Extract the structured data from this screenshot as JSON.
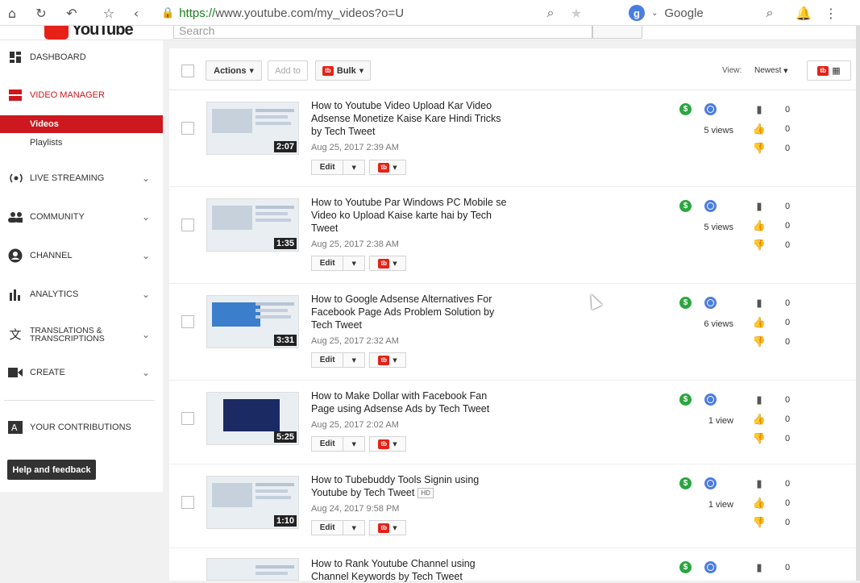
{
  "browser": {
    "url_secure": "https://",
    "url_rest": "www.youtube.com/my_videos?o=U",
    "search_engine": "Google"
  },
  "yt_header": {
    "logo_text": "YouTube",
    "search_placeholder": "Search"
  },
  "sidebar": {
    "items": [
      {
        "label": "DASHBOARD",
        "icon": "dashboard-icon"
      },
      {
        "label": "VIDEO MANAGER",
        "icon": "video-manager-icon"
      },
      {
        "label": "LIVE STREAMING",
        "icon": "live-icon"
      },
      {
        "label": "COMMUNITY",
        "icon": "community-icon"
      },
      {
        "label": "CHANNEL",
        "icon": "channel-icon"
      },
      {
        "label": "ANALYTICS",
        "icon": "analytics-icon"
      },
      {
        "label": "TRANSLATIONS & TRANSCRIPTIONS",
        "icon": "translate-icon"
      },
      {
        "label": "CREATE",
        "icon": "create-icon"
      },
      {
        "label": "YOUR CONTRIBUTIONS",
        "icon": "contributions-icon"
      }
    ],
    "sub_videos": "Videos",
    "sub_playlists": "Playlists",
    "help_label": "Help and feedback"
  },
  "toolbar": {
    "actions_label": "Actions",
    "addto_label": "Add to",
    "bulk_label": "Bulk",
    "view_label": "View:",
    "view_value": "Newest"
  },
  "edit_label": "Edit",
  "videos": [
    {
      "title": "How to Youtube Video Upload Kar Video Adsense Monetize Kaise Kare Hindi Tricks by Tech Tweet",
      "date": "Aug 25, 2017 2:39 AM",
      "duration": "2:07",
      "views": "5 views",
      "comments": "0",
      "likes": "0",
      "dislikes": "0"
    },
    {
      "title": "How to Youtube Par Windows PC Mobile se Video ko Upload Kaise karte hai by Tech Tweet",
      "date": "Aug 25, 2017 2:38 AM",
      "duration": "1:35",
      "views": "5 views",
      "comments": "0",
      "likes": "0",
      "dislikes": "0"
    },
    {
      "title": "How to Google Adsense Alternatives For Facebook Page Ads Problem Solution by Tech Tweet",
      "date": "Aug 25, 2017 2:32 AM",
      "duration": "3:31",
      "views": "6 views",
      "comments": "0",
      "likes": "0",
      "dislikes": "0"
    },
    {
      "title": "How to Make Dollar with Facebook Fan Page using Adsense Ads by Tech Tweet",
      "date": "Aug 25, 2017 2:02 AM",
      "duration": "5:25",
      "views": "1 view",
      "comments": "0",
      "likes": "0",
      "dislikes": "0"
    },
    {
      "title": "How to Tubebuddy Tools Signin using Youtube by Tech Tweet",
      "hd": "HD",
      "date": "Aug 24, 2017 9:58 PM",
      "duration": "1:10",
      "views": "1 view",
      "comments": "0",
      "likes": "0",
      "dislikes": "0"
    },
    {
      "title": "How to Rank Youtube Channel using Channel Keywords by Tech Tweet",
      "date": "",
      "duration": "",
      "views": "",
      "comments": "0",
      "likes": "",
      "dislikes": ""
    }
  ]
}
